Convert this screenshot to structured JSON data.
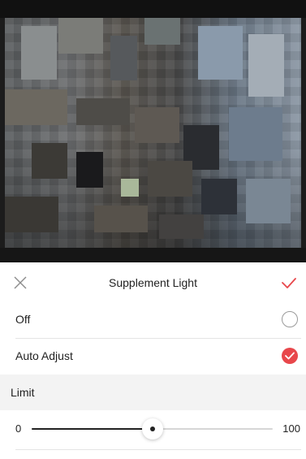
{
  "panel": {
    "title": "Supplement Light",
    "close_icon": "close-icon",
    "confirm_icon": "checkmark-icon",
    "accent_color": "#e8474b"
  },
  "options": [
    {
      "label": "Off",
      "selected": false
    },
    {
      "label": "Auto Adjust",
      "selected": true
    }
  ],
  "limit": {
    "label": "Limit",
    "min_label": "0",
    "max_label": "100",
    "value": 50
  }
}
